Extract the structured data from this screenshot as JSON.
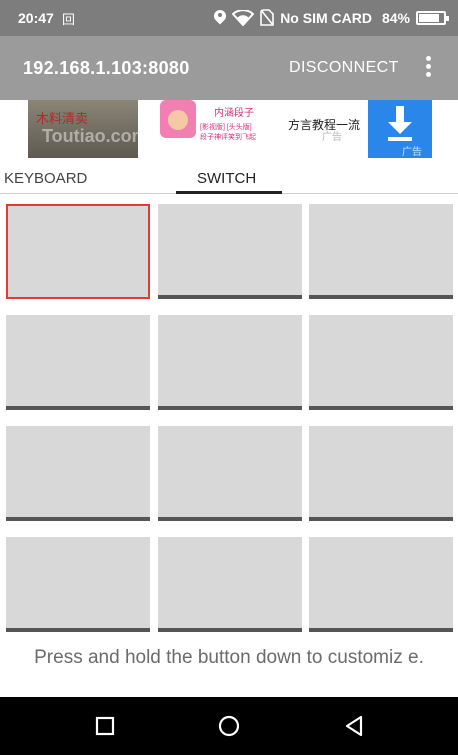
{
  "status_bar": {
    "time": "20:47",
    "gallery_glyph": "回",
    "location_icon": "location-pin-icon",
    "wifi_icon": "wifi-icon",
    "sim_icon": "no-sim-icon",
    "sim_status": "No SIM CARD",
    "battery_text": "84%",
    "battery_level": 0.84
  },
  "app_bar": {
    "title": "192.168.1.103:8080",
    "disconnect_label": "DISCONNECT",
    "more_icon": "more-vert-icon"
  },
  "ad": {
    "photo_text": "木料清卖",
    "watermark": "Toutiao.com",
    "promo_title": "内涵段子",
    "promo_sub": "[影视版] [头头版]",
    "promo_sub2": "段子神评笑到飞起",
    "headline": "方言教程一流",
    "ad_label": "广告",
    "ad_label2": "广告",
    "download_icon": "download-icon"
  },
  "tabs": [
    {
      "label": "KEYBOARD",
      "selected": false
    },
    {
      "label": "SWITCH",
      "selected": true
    }
  ],
  "switch_grid": {
    "rows": 4,
    "cols": 3,
    "selected_index": 0
  },
  "hint": "Press and hold the button down to customiz e.",
  "nav_bar": {
    "recents_icon": "recents-square-icon",
    "home_icon": "home-circle-icon",
    "back_icon": "back-triangle-icon"
  },
  "colors": {
    "status_bar": "#7d7d7d",
    "app_bar": "#9b9b9b",
    "button_fill": "#d8d8d8",
    "selected_border": "#e53935",
    "download_blue": "#2a86e8"
  }
}
